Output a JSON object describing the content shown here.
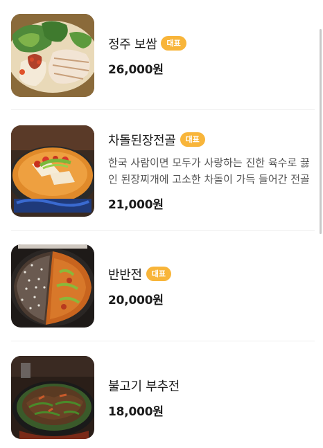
{
  "menu": {
    "items": [
      {
        "name": "정주 보쌈",
        "badge": "대표",
        "description": "",
        "price": "26,000원",
        "image_icon": "bossam-photo"
      },
      {
        "name": "차돌된장전골",
        "badge": "대표",
        "description": "한국 사람이면 모두가 사랑하는 진한 육수로 끓인 된장찌개에 고소한 차돌이 가득 들어간 전골",
        "price": "21,000원",
        "image_icon": "doenjang-hotpot-photo"
      },
      {
        "name": "반반전",
        "badge": "대표",
        "description": "",
        "price": "20,000원",
        "image_icon": "half-half-pancake-photo"
      },
      {
        "name": "불고기 부추전",
        "badge": "",
        "description": "",
        "price": "18,000원",
        "image_icon": "bulgogi-chive-pancake-photo"
      }
    ]
  },
  "colors": {
    "badge": "#f8b53a",
    "text": "#1a1a1a",
    "description": "#555555",
    "divider": "#efefef"
  }
}
